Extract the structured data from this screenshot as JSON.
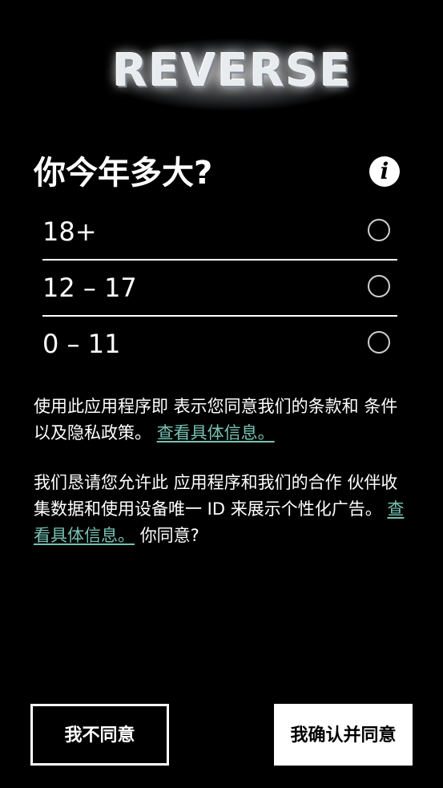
{
  "app": {
    "logo_text": "REVERSE"
  },
  "question": {
    "title": "你今年多大?"
  },
  "age_options": [
    {
      "label": "18+",
      "selected": false
    },
    {
      "label": "12 – 17",
      "selected": false
    },
    {
      "label": "0 – 11",
      "selected": false
    }
  ],
  "consent": {
    "terms_text": "使用此应用程序即 表示您同意我们的条款和 条件以及隐私政策。",
    "terms_link": "查看具体信息。",
    "ads_text": "我们恳请您允许此 应用程序和我们的合作 伙伴收集数据和使用设备唯一 ID 来展示个性化广告。",
    "ads_link": "查看具体信息。",
    "ads_question": "你同意?"
  },
  "buttons": {
    "decline": "我不同意",
    "accept": "我确认并同意"
  },
  "colors": {
    "background": "#000000",
    "text": "#ffffff",
    "link": "#77c2b3"
  }
}
